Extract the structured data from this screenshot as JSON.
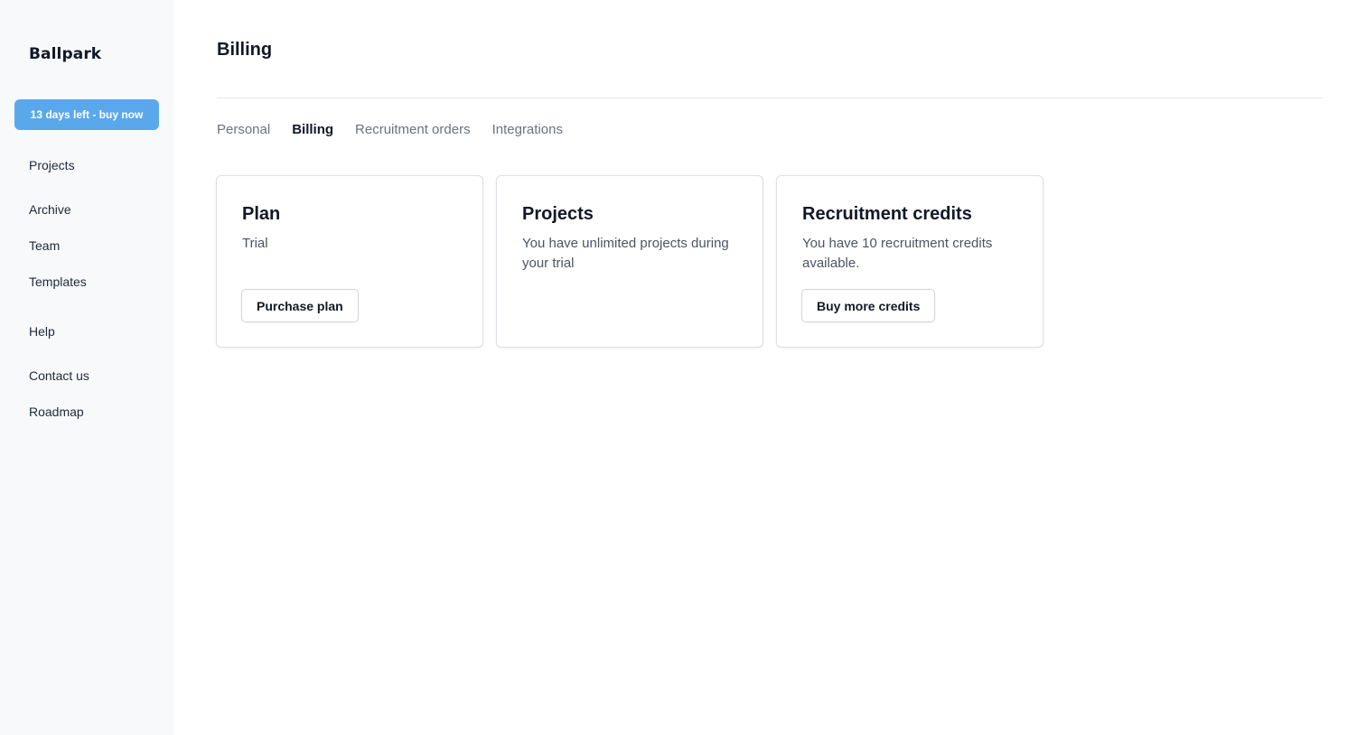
{
  "sidebar": {
    "logo": "Ballpark",
    "trial_button": "13 days left - buy now",
    "primary_nav": [
      {
        "label": "Projects"
      },
      {
        "label": "Archive"
      },
      {
        "label": "Team"
      },
      {
        "label": "Templates"
      }
    ],
    "secondary_nav": [
      {
        "label": "Help"
      },
      {
        "label": "Contact us"
      },
      {
        "label": "Roadmap"
      }
    ]
  },
  "main": {
    "title": "Billing",
    "tabs": [
      {
        "label": "Personal",
        "active": false
      },
      {
        "label": "Billing",
        "active": true
      },
      {
        "label": "Recruitment orders",
        "active": false
      },
      {
        "label": "Integrations",
        "active": false
      }
    ],
    "cards": [
      {
        "title": "Plan",
        "text": "Trial",
        "button": "Purchase plan"
      },
      {
        "title": "Projects",
        "text": "You have unlimited projects during your trial",
        "button": null
      },
      {
        "title": "Recruitment credits",
        "text": "You have 10 recruitment credits available.",
        "button": "Buy more credits"
      }
    ]
  },
  "colors": {
    "accent": "#5aa8ec",
    "sidebar_bg": "#f8f9fb"
  }
}
